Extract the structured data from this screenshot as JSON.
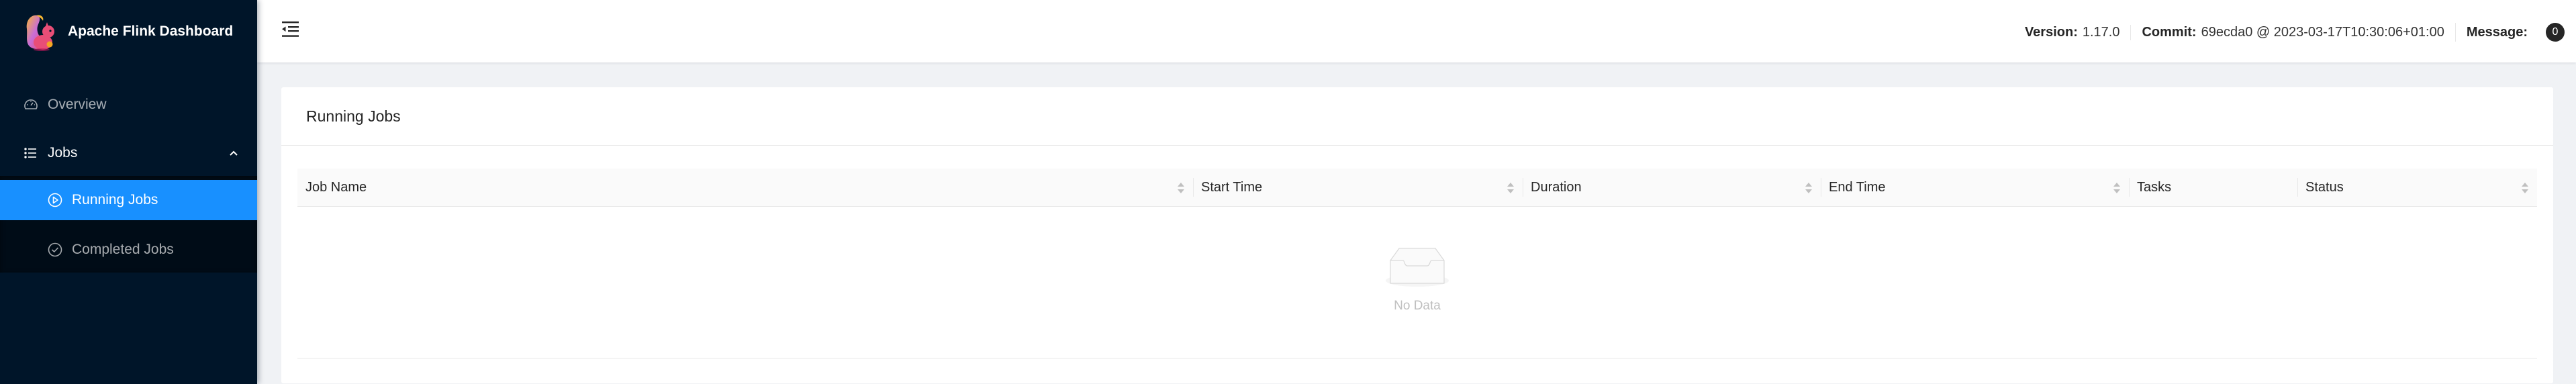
{
  "app": {
    "title": "Apache Flink Dashboard",
    "logo_icon": "flink-squirrel-logo"
  },
  "sidebar": {
    "items": [
      {
        "label": "Overview",
        "icon": "dashboard-icon",
        "active": false
      },
      {
        "label": "Jobs",
        "icon": "unordered-list-icon",
        "expanded": true,
        "children": [
          {
            "label": "Running Jobs",
            "icon": "play-circle-icon",
            "active": true
          },
          {
            "label": "Completed Jobs",
            "icon": "check-circle-icon",
            "active": false
          }
        ]
      }
    ]
  },
  "header": {
    "fold_icon": "menu-fold-icon",
    "version_label": "Version:",
    "version_value": "1.17.0",
    "commit_label": "Commit:",
    "commit_value": "69ecda0 @ 2023-03-17T10:30:06+01:00",
    "message_label": "Message:",
    "message_count": "0"
  },
  "main": {
    "card_title": "Running Jobs",
    "table": {
      "columns": [
        {
          "label": "Job Name",
          "sortable": true
        },
        {
          "label": "Start Time",
          "sortable": true
        },
        {
          "label": "Duration",
          "sortable": true
        },
        {
          "label": "End Time",
          "sortable": true
        },
        {
          "label": "Tasks",
          "sortable": false
        },
        {
          "label": "Status",
          "sortable": true
        }
      ],
      "rows": [],
      "empty_text": "No Data"
    }
  },
  "colors": {
    "sidebar_bg": "#001529",
    "submenu_bg": "#000c17",
    "accent": "#1890ff",
    "page_bg": "#f0f2f5"
  }
}
